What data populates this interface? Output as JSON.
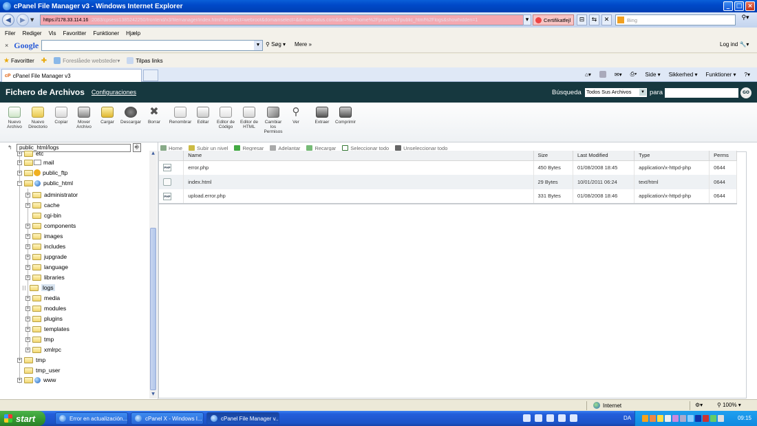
{
  "window": {
    "title": "cPanel File Manager v3 - Windows Internet Explorer"
  },
  "address": {
    "host": "https://178.33.114.16",
    "path": ":2083/cpsess1385242250/frontend/x3/filemanager/index.html?dirselect=webroot&domainselect=&dirnavstatus.com&dir=%2Fhome%2Fpravit%2Fpublic_html%2Flogs&showhidden=1",
    "cert": "Certifikatfejl",
    "bing_placeholder": "Bing"
  },
  "menu": [
    "Filer",
    "Rediger",
    "Vis",
    "Favoritter",
    "Funktioner",
    "Hjælp"
  ],
  "google": {
    "logo": "Google",
    "sog": "Søg",
    "mere": "Mere",
    "login": "Log ind"
  },
  "favorites": {
    "label": "Favoritter",
    "items": [
      "Foreslåede websteder",
      "Tilpas links"
    ]
  },
  "tab": {
    "title": "cPanel File Manager v3",
    "brand": "cP"
  },
  "tab_cmds": {
    "side": "Side",
    "sikkerhed": "Sikkerhed",
    "funktioner": "Funktioner"
  },
  "header": {
    "title": "Fichero de Archivos",
    "config": "Configuraciones",
    "search_label": "Búsqueda",
    "search_scope": "Todos Sus Archivos",
    "para": "para",
    "go": "GO"
  },
  "tools": [
    "Nuevo Archivo",
    "Nuevo Directorio",
    "Copiar",
    "Mover Archivo",
    "Cargar",
    "Descargar",
    "Borrar",
    "Renombrar",
    "Editar",
    "Editor de Código",
    "Editor de HTML",
    "Cambiar los Permisos",
    "Ver",
    "Extraer",
    "Comprimir"
  ],
  "tree": {
    "path": "public_html/logs",
    "items": [
      {
        "label": "etc"
      },
      {
        "label": "mail"
      },
      {
        "label": "public_ftp"
      },
      {
        "label": "public_html"
      },
      {
        "label": "administrator"
      },
      {
        "label": "cache"
      },
      {
        "label": "cgi-bin"
      },
      {
        "label": "components"
      },
      {
        "label": "images"
      },
      {
        "label": "includes"
      },
      {
        "label": "jupgrade"
      },
      {
        "label": "language"
      },
      {
        "label": "libraries"
      },
      {
        "label": "logs"
      },
      {
        "label": "media"
      },
      {
        "label": "modules"
      },
      {
        "label": "plugins"
      },
      {
        "label": "templates"
      },
      {
        "label": "tmp"
      },
      {
        "label": "xmlrpc"
      },
      {
        "label": "tmp"
      },
      {
        "label": "tmp_user"
      },
      {
        "label": "www"
      }
    ]
  },
  "nav": [
    "Home",
    "Subir un nivel",
    "Regresar",
    "Adelantar",
    "Recargar",
    "Seleccionar todo",
    "Unseleccionar todo"
  ],
  "table": {
    "headers": [
      "Name",
      "Size",
      "Last Modified",
      "Type",
      "Perms"
    ],
    "rows": [
      {
        "icon": "PHP",
        "name": "error.php",
        "size": "450 Bytes",
        "modified": "01/08/2008 18:45",
        "type": "application/x-httpd-php",
        "perms": "0644"
      },
      {
        "icon": "",
        "name": "index.html",
        "size": "29 Bytes",
        "modified": "10/01/2011 06:24",
        "type": "text/html",
        "perms": "0644"
      },
      {
        "icon": "PHP",
        "name": "upload.error.php",
        "size": "331 Bytes",
        "modified": "01/08/2008 18:46",
        "type": "application/x-httpd-php",
        "perms": "0644"
      }
    ]
  },
  "status": {
    "zone": "Internet",
    "zoom": "100%"
  },
  "taskbar": {
    "start": "start",
    "tasks": [
      "Error en actualización...",
      "cPanel X - Windows I...",
      "cPanel File Manager v..."
    ],
    "lang": "DA",
    "clock": "09:15"
  }
}
